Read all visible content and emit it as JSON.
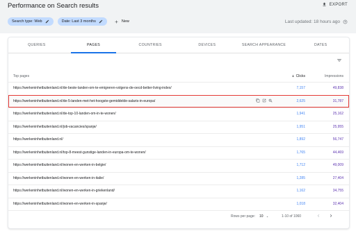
{
  "header": {
    "title": "Performance on Search results",
    "export_label": "EXPORT",
    "filters": [
      {
        "label": "Search type: Web"
      },
      {
        "label": "Date: Last 3 months"
      }
    ],
    "new_label": "New",
    "updated": "Last updated: 18 hours ago"
  },
  "tabs": [
    "QUERIES",
    "PAGES",
    "COUNTRIES",
    "DEVICES",
    "SEARCH APPEARANCE",
    "DATES"
  ],
  "active_tab": "PAGES",
  "table": {
    "col_page": "Top pages",
    "col_clicks": "Clicks",
    "col_impressions": "Impressions",
    "rows": [
      {
        "url": "https://werkeninhetbuitenland.nl/de-beste-landen-om-te-emigreren-volgens-de-oecd-better-living-index/",
        "clicks": "7,157",
        "impressions": "49,838"
      },
      {
        "url": "https://werkeninhetbuitenland.nl/de-5-landen-met-het-hoogste-gemiddelde-salaris-in-europa/",
        "clicks": "2,625",
        "impressions": "31,787"
      },
      {
        "url": "https://werkeninhetbuitenland.nl/de-top-10-landen-om-in-te-wonen/",
        "clicks": "1,941",
        "impressions": "25,162"
      },
      {
        "url": "https://werkeninhetbuitenland.nl/job-vacancies/spanje/",
        "clicks": "1,951",
        "impressions": "25,955"
      },
      {
        "url": "https://werkeninhetbuitenland.nl/",
        "clicks": "1,892",
        "impressions": "56,747"
      },
      {
        "url": "https://werkeninhetbuitenland.nl/top-8-meest-gunstige-landen-in-europa-om-te-wonen/",
        "clicks": "1,765",
        "impressions": "44,469"
      },
      {
        "url": "https://werkeninhetbuitenland.nl/wonen-en-werken-in-belgie/",
        "clicks": "1,712",
        "impressions": "49,009"
      },
      {
        "url": "https://werkeninhetbuitenland.nl/wonen-en-werken-in-italie/",
        "clicks": "1,285",
        "impressions": "27,404"
      },
      {
        "url": "https://werkeninhetbuitenland.nl/wonen-en-werken-in-griekenland/",
        "clicks": "1,162",
        "impressions": "34,755"
      },
      {
        "url": "https://werkeninhetbuitenland.nl/wonen-en-werken-in-spanje/",
        "clicks": "1,018",
        "impressions": "32,404"
      }
    ]
  },
  "pager": {
    "rows_per_page_label": "Rows per page:",
    "rows_per_page": "10",
    "range": "1-10 of 1060"
  },
  "colors": {
    "accent": "#1a73e8",
    "clicks": "#4285f4",
    "impressions": "#5e35b1",
    "highlight": "#e53935"
  },
  "icons": [
    "download-icon",
    "pencil-icon",
    "plus-icon",
    "help-icon",
    "filter-icon",
    "sort-arrow-icon",
    "copy-icon",
    "open-external-icon",
    "inspect-icon",
    "dropdown-icon",
    "chevron-left-icon",
    "chevron-right-icon"
  ]
}
